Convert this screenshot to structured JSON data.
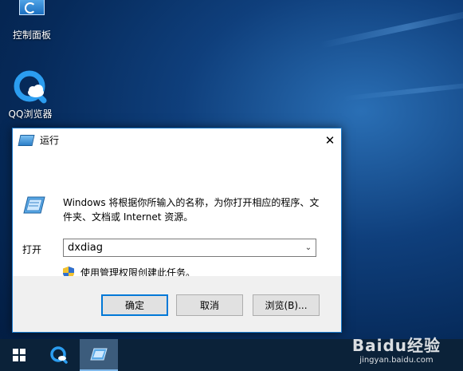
{
  "desktop": {
    "icons": [
      {
        "label": "控制面板"
      },
      {
        "label": "QQ浏览器"
      }
    ]
  },
  "dialog": {
    "title": "运行",
    "close_glyph": "✕",
    "description": "Windows 将根据你所输入的名称，为你打开相应的程序、文件夹、文档或 Internet 资源。",
    "open_label": "打开",
    "input_value": "dxdiag",
    "dropdown_glyph": "⌄",
    "admin_text": "使用管理权限创建此任务。",
    "buttons": {
      "ok": "确定",
      "cancel": "取消",
      "browse": "浏览(B)..."
    }
  },
  "watermark": {
    "brand": "Baidu经验",
    "url": "jingyan.baidu.com"
  },
  "colors": {
    "accent": "#0078d7",
    "title_border": "#1979ca",
    "taskbar": "#0b2239"
  }
}
